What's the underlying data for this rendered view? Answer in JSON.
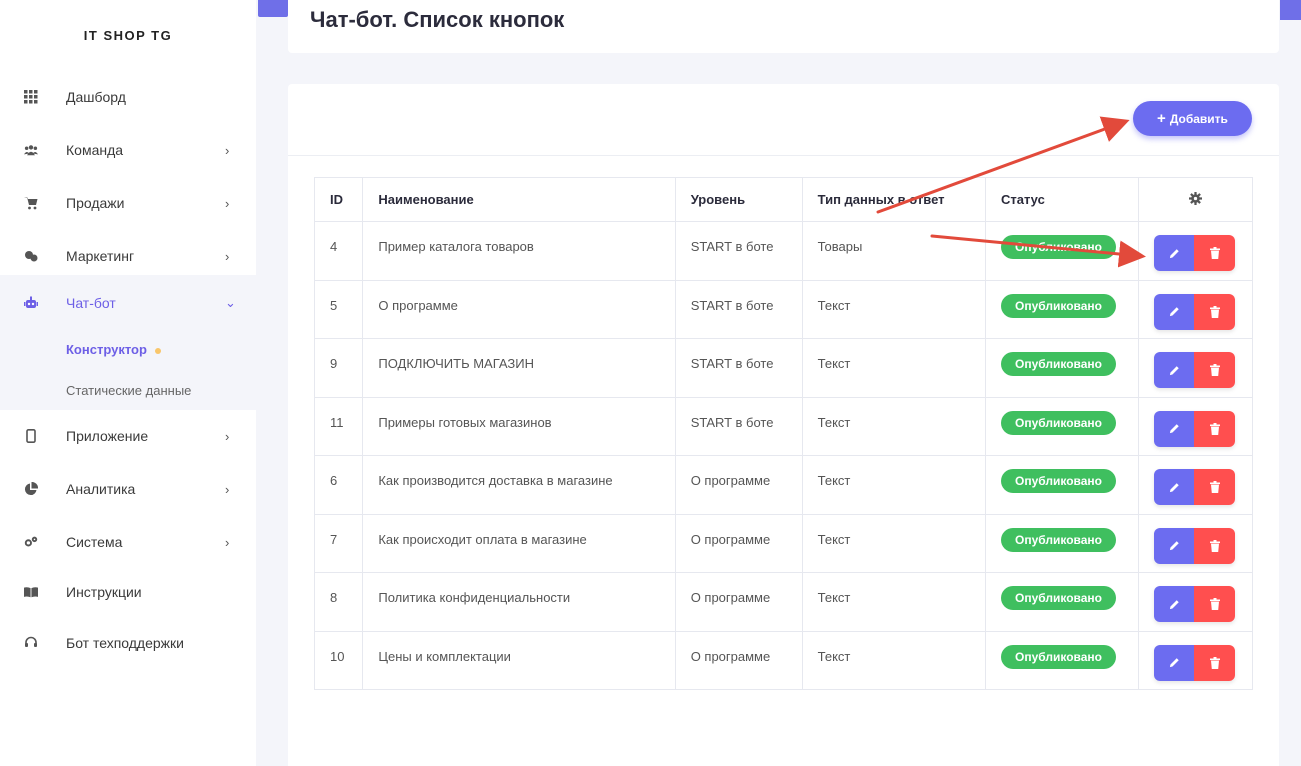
{
  "sidebar": {
    "brand": "IT SHOP TG",
    "items": [
      {
        "label": "Дашборд",
        "icon": "grid-icon",
        "chevron": ""
      },
      {
        "label": "Команда",
        "icon": "users-icon",
        "chevron": "›"
      },
      {
        "label": "Продажи",
        "icon": "cart-icon",
        "chevron": "›"
      },
      {
        "label": "Маркетинг",
        "icon": "megaphone-icon",
        "chevron": "›"
      },
      {
        "label": "Чат-бот",
        "icon": "robot-icon",
        "chevron": "⌄"
      },
      {
        "label": "Приложение",
        "icon": "mobile-icon",
        "chevron": "›"
      },
      {
        "label": "Аналитика",
        "icon": "pie-chart-icon",
        "chevron": "›"
      },
      {
        "label": "Система",
        "icon": "gears-icon",
        "chevron": "›"
      },
      {
        "label": "Инструкции",
        "icon": "book-icon",
        "chevron": ""
      },
      {
        "label": "Бот техподдержки",
        "icon": "headset-icon",
        "chevron": ""
      }
    ],
    "submenu": [
      {
        "label": "Конструктор"
      },
      {
        "label": "Статические данные"
      }
    ]
  },
  "header": {
    "title": "Чат-бот. Список кнопок"
  },
  "toolbar": {
    "add_label": "Добавить",
    "add_icon": "plus-icon"
  },
  "table": {
    "headers": {
      "id": "ID",
      "name": "Наименование",
      "level": "Уровень",
      "type": "Тип данных в ответ",
      "status": "Статус",
      "actions_icon": "gear-icon"
    },
    "rows": [
      {
        "id": "4",
        "name": "Пример каталога товаров",
        "level": "START в боте",
        "type": "Товары",
        "status": "Опубликовано"
      },
      {
        "id": "5",
        "name": "О программе",
        "level": "START в боте",
        "type": "Текст",
        "status": "Опубликовано"
      },
      {
        "id": "9",
        "name": "ПОДКЛЮЧИТЬ МАГАЗИН",
        "level": "START в боте",
        "type": "Текст",
        "status": "Опубликовано"
      },
      {
        "id": "11",
        "name": "Примеры готовых магазинов",
        "level": "START в боте",
        "type": "Текст",
        "status": "Опубликовано"
      },
      {
        "id": "6",
        "name": "Как производится доставка в магазине",
        "level": "О программе",
        "type": "Текст",
        "status": "Опубликовано"
      },
      {
        "id": "7",
        "name": "Как происходит оплата в магазине",
        "level": "О программе",
        "type": "Текст",
        "status": "Опубликовано"
      },
      {
        "id": "8",
        "name": "Политика конфиденциальности",
        "level": "О программе",
        "type": "Текст",
        "status": "Опубликовано"
      },
      {
        "id": "10",
        "name": "Цены и комплектации",
        "level": "О программе",
        "type": "Текст",
        "status": "Опубликовано"
      }
    ]
  },
  "colors": {
    "accent": "#6c6cf0",
    "active_nav": "#6d5fe6",
    "success": "#3fbf5f",
    "danger": "#ff4f4f",
    "annotation": "#e24a3b"
  }
}
